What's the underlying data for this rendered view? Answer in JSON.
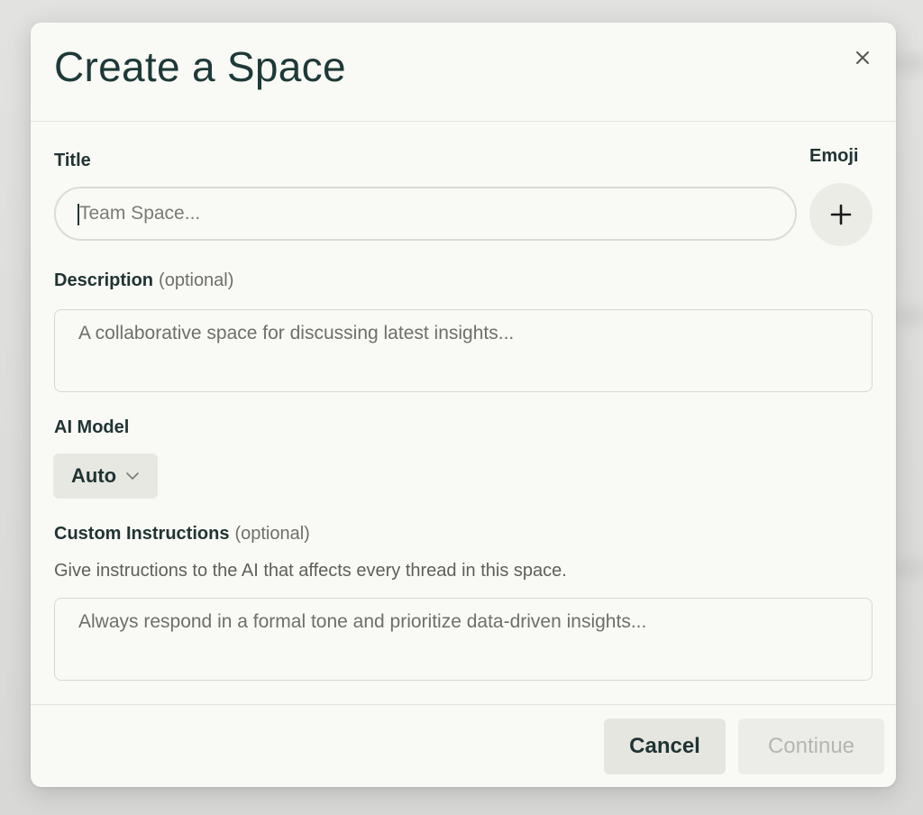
{
  "dialog": {
    "title": "Create a Space",
    "close_label": "×"
  },
  "title_field": {
    "label": "Title",
    "placeholder": "Team Space...",
    "value": ""
  },
  "emoji": {
    "label": "Emoji",
    "button_icon": "plus-icon"
  },
  "description_field": {
    "label": "Description",
    "optional": "(optional)",
    "placeholder": "A collaborative space for discussing latest insights...",
    "value": ""
  },
  "ai_model": {
    "label": "AI Model",
    "selected": "Auto",
    "icon": "chevron-down-icon"
  },
  "custom_instructions": {
    "label": "Custom Instructions",
    "optional": "(optional)",
    "help": "Give instructions to the AI that affects every thread in this space.",
    "placeholder": "Always respond in a formal tone and prioritize data-driven insights...",
    "value": ""
  },
  "footer": {
    "cancel_label": "Cancel",
    "continue_label": "Continue"
  },
  "colors": {
    "title": "#1d3a38",
    "surface": "#f9f9f5",
    "disabled_text": "#b6b6b1"
  }
}
